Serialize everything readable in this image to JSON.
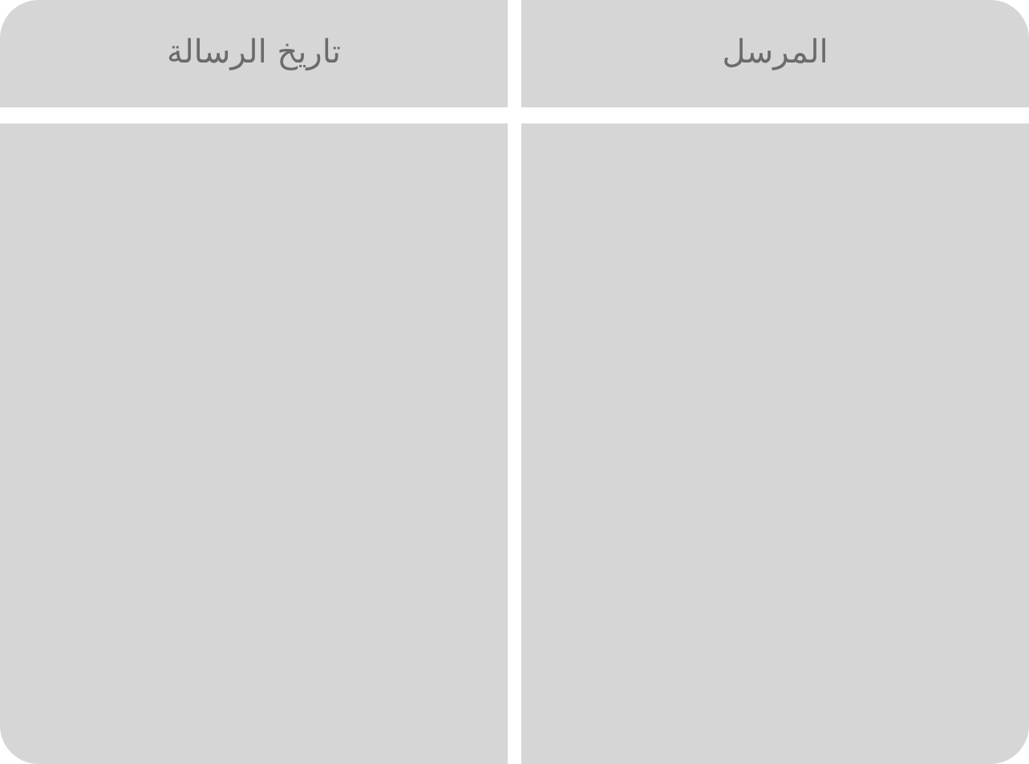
{
  "table": {
    "columns": [
      {
        "key": "sender",
        "label": "المرسل"
      },
      {
        "key": "message_date",
        "label": "تاريخ الرسالة"
      }
    ],
    "rows": []
  },
  "colors": {
    "cell_background": "#d6d6d6",
    "header_text": "#6b6b6b",
    "gap": "#ffffff"
  }
}
